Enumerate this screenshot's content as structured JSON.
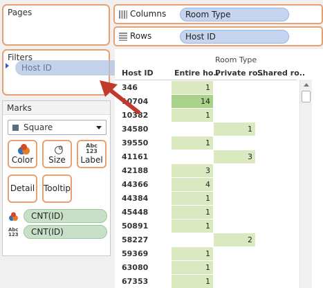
{
  "pages": {
    "title": "Pages"
  },
  "filters": {
    "title": "Filters",
    "dragging_field": "Host ID"
  },
  "marks": {
    "title": "Marks",
    "mark_type": "Square",
    "buttons": {
      "color": "Color",
      "size": "Size",
      "label": "Label",
      "detail": "Detail",
      "tooltip": "Tooltip"
    },
    "abc_line1": "Abc",
    "abc_line2": "123",
    "fields": [
      "CNT(ID)",
      "CNT(ID)"
    ]
  },
  "columns": {
    "label": "Columns",
    "pill": "Room Type"
  },
  "rows": {
    "label": "Rows",
    "pill": "Host ID"
  },
  "table": {
    "column_group": "Room Type",
    "row_header": "Host ID",
    "col_headers": [
      "Entire ho..",
      "Private ro..",
      "Shared ro.."
    ],
    "rows": [
      {
        "id": "346",
        "entire": "1",
        "private": ""
      },
      {
        "id": "10704",
        "entire": "14",
        "private": ""
      },
      {
        "id": "10382",
        "entire": "1",
        "private": ""
      },
      {
        "id": "34580",
        "entire": "",
        "private": "1"
      },
      {
        "id": "39550",
        "entire": "1",
        "private": ""
      },
      {
        "id": "41161",
        "entire": "",
        "private": "3"
      },
      {
        "id": "42188",
        "entire": "3",
        "private": ""
      },
      {
        "id": "44366",
        "entire": "4",
        "private": ""
      },
      {
        "id": "44384",
        "entire": "1",
        "private": ""
      },
      {
        "id": "45448",
        "entire": "1",
        "private": ""
      },
      {
        "id": "50891",
        "entire": "1",
        "private": ""
      },
      {
        "id": "58227",
        "entire": "",
        "private": "2"
      },
      {
        "id": "59369",
        "entire": "1",
        "private": ""
      },
      {
        "id": "63080",
        "entire": "1",
        "private": ""
      },
      {
        "id": "67353",
        "entire": "1",
        "private": ""
      }
    ]
  },
  "colors": {
    "card_border": "#e8a070",
    "arrow": "#c0392b",
    "cell_light": "#dbe9c0",
    "cell_dark": "#a9d38a"
  }
}
